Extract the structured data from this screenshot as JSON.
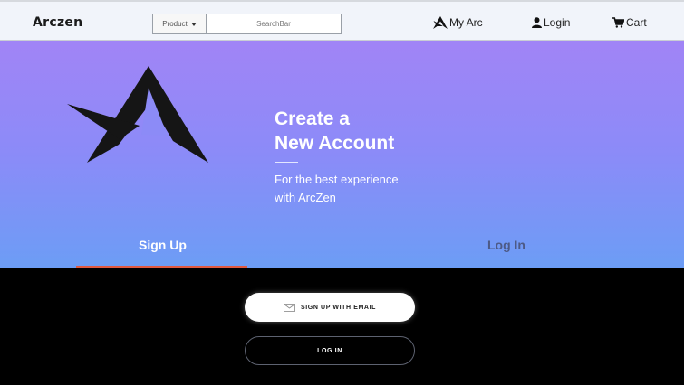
{
  "navbar": {
    "logo": "Arczen",
    "product_select": "Product",
    "search_placeholder": "SearchBar",
    "my_arc": "My Arc",
    "login": "Login",
    "cart": "Cart"
  },
  "hero": {
    "title_line1": "Create a",
    "title_line2": "New Account",
    "subtitle_line1": "For the best experience",
    "subtitle_line2": "with ArcZen",
    "tab_signup": "Sign Up",
    "tab_login": "Log In"
  },
  "actions": {
    "email_button": "SIGN UP WITH EMAIL",
    "login_button": "LOG IN"
  },
  "colors": {
    "accent_underline": "#e05a41",
    "gradient_top": "#a184f6",
    "gradient_bottom": "#6c9df5"
  }
}
